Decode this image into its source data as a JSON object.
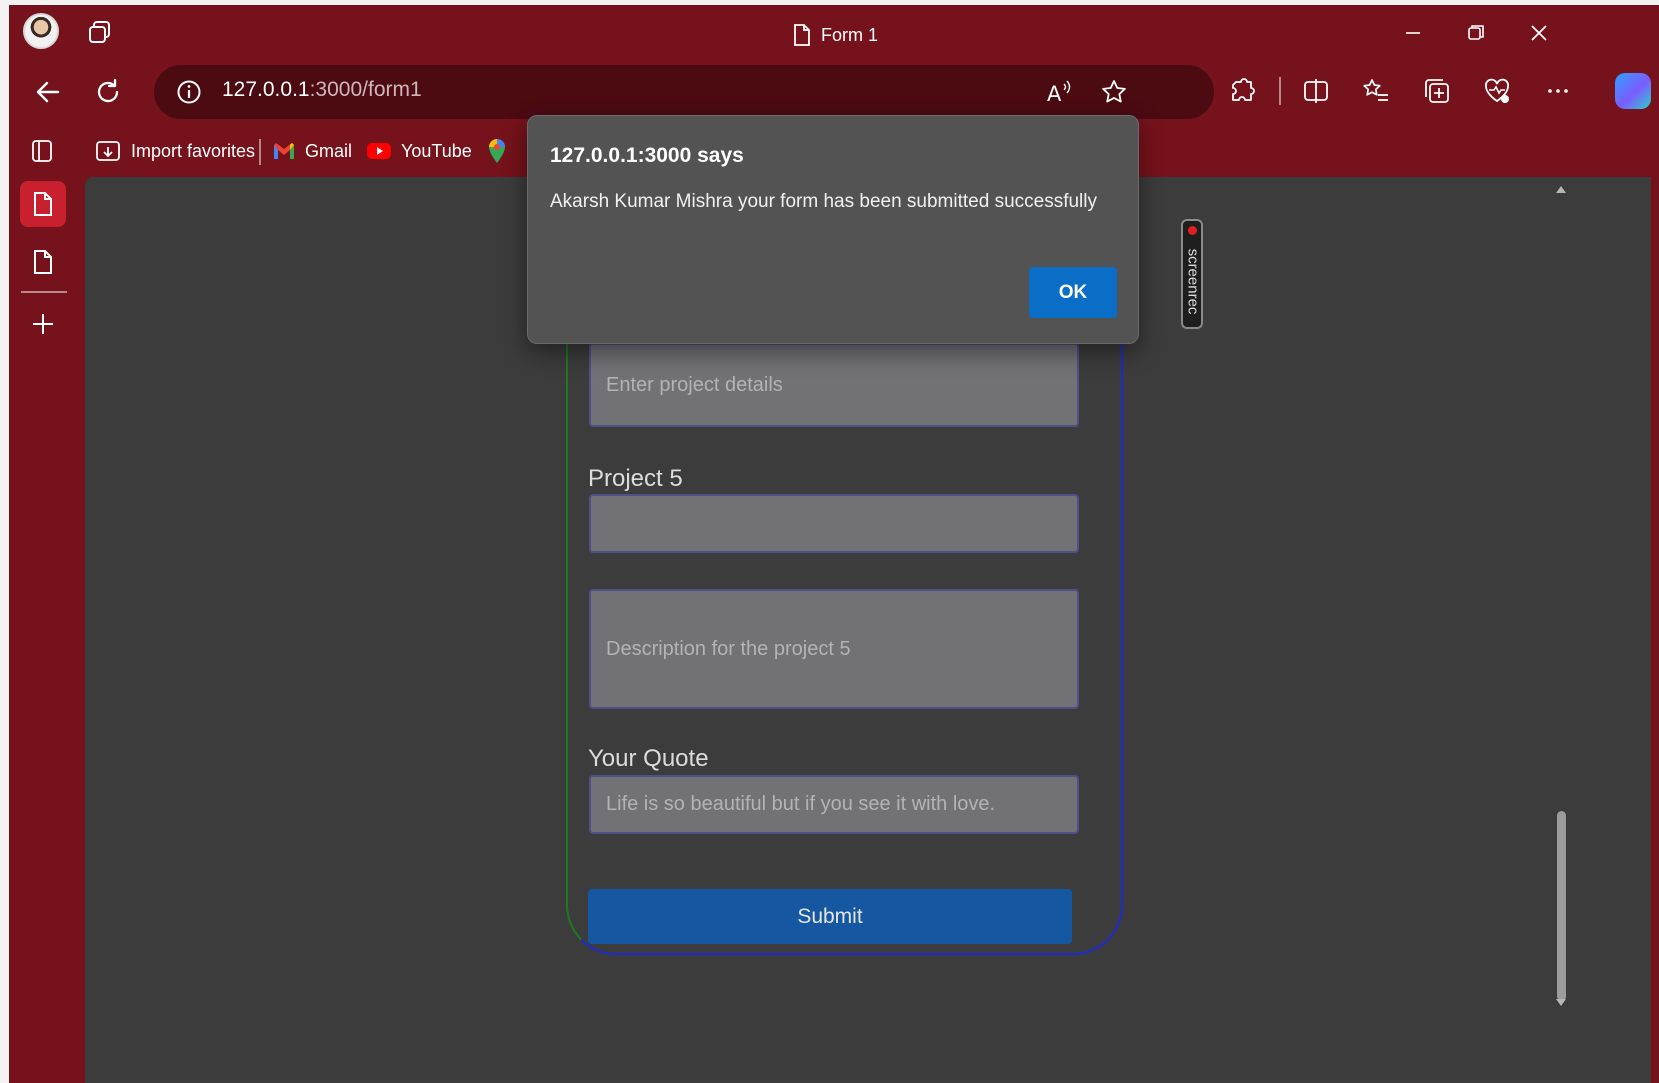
{
  "window": {
    "tab_title": "Form 1"
  },
  "address_bar": {
    "host": "127.0.0.1",
    "path": ":3000/form1"
  },
  "favorites": [
    {
      "label": "Import favorites",
      "icon": "import-favorites-icon"
    },
    {
      "label": "Gmail",
      "icon": "gmail-icon"
    },
    {
      "label": "YouTube",
      "icon": "youtube-icon"
    },
    {
      "label": "",
      "icon": "maps-icon"
    }
  ],
  "form": {
    "project_details_placeholder": "Enter project details",
    "project5_label": "Project 5",
    "project5_value": "",
    "project5_description_placeholder": "Description for the project 5",
    "quote_label": "Your Quote",
    "quote_value": "Life is so beautiful but if you see it with love.",
    "submit_label": "Submit"
  },
  "dialog": {
    "title": "127.0.0.1:3000 says",
    "message": "Akarsh Kumar Mishra your form has been submitted successfully",
    "ok_label": "OK"
  },
  "screenrec": {
    "label": "screenrec"
  },
  "colors": {
    "browser_frame": "#76121b",
    "address_bar": "#4c0a11",
    "page_bg": "#3c3c3c",
    "submit_button": "#1558a1",
    "ok_button": "#0a6ec7",
    "active_tab": "#c8202e"
  }
}
